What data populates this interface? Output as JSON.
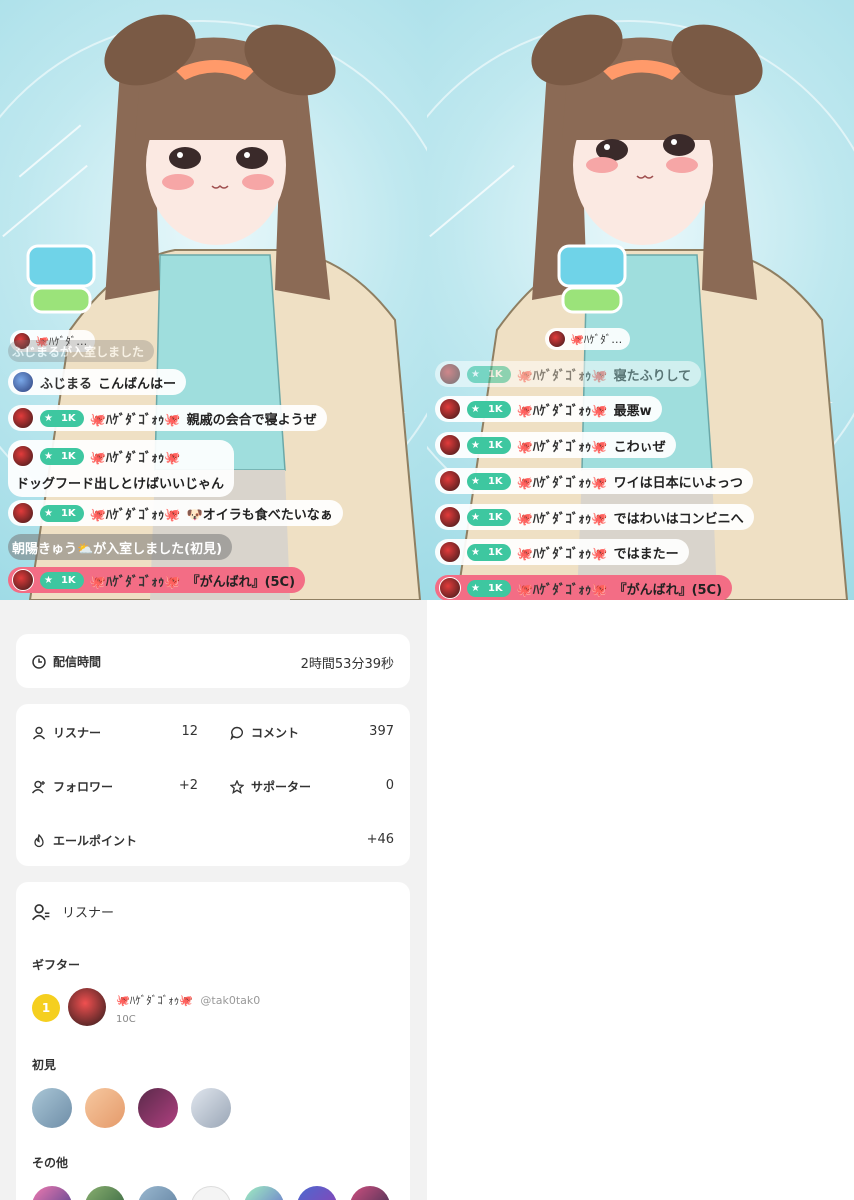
{
  "left_stream": {
    "sticker_alt": "カツんばれ",
    "notice_top": "ふじまるが入室しました",
    "mini_tag": "🐙ﾊｹﾞﾀﾞ…",
    "messages": [
      {
        "user": "ふじまる",
        "text": "こんばんはー"
      },
      {
        "badge": "1K",
        "user": "🐙ﾊｹﾞﾀﾞｺﾞｫｩ🐙",
        "text": "親戚の会合で寝ようぜ"
      },
      {
        "badge": "1K",
        "user": "🐙ﾊｹﾞﾀﾞｺﾞｫｩ🐙",
        "text": "ドッグフード出しとけばいいじゃん"
      },
      {
        "badge": "1K",
        "user": "🐙ﾊｹﾞﾀﾞｺﾞｫｩ🐙",
        "text": "🐶オイラも食べたいなぁ"
      },
      {
        "text": "朝陽きゅう⛅が入室しました(初見)"
      },
      {
        "badge": "1K",
        "user": "🐙ﾊｹﾞﾀﾞｺﾞｫｩ🐙",
        "text": "『がんばれ』(5C)"
      }
    ]
  },
  "right_stream": {
    "sticker_alt": "カツんばれ",
    "mini_tag": "🐙ﾊｹﾞﾀﾞ…",
    "messages": [
      {
        "badge": "1K",
        "user": "🐙ﾊｹﾞﾀﾞｺﾞｫｩ🐙",
        "text": "寝たふりして"
      },
      {
        "badge": "1K",
        "user": "🐙ﾊｹﾞﾀﾞｺﾞｫｩ🐙",
        "text": "最悪w"
      },
      {
        "badge": "1K",
        "user": "🐙ﾊｹﾞﾀﾞｺﾞｫｩ🐙",
        "text": "こわぃぜ"
      },
      {
        "badge": "1K",
        "user": "🐙ﾊｹﾞﾀﾞｺﾞｫｩ🐙",
        "text": "ワイは日本にいよっつ"
      },
      {
        "badge": "1K",
        "user": "🐙ﾊｹﾞﾀﾞｺﾞｫｩ🐙",
        "text": "ではわいはコンビニへ"
      },
      {
        "badge": "1K",
        "user": "🐙ﾊｹﾞﾀﾞｺﾞｫｩ🐙",
        "text": "ではまたー"
      },
      {
        "badge": "1K",
        "user": "🐙ﾊｹﾞﾀﾞｺﾞｫｩ🐙",
        "text": "『がんばれ』(5C)"
      }
    ]
  },
  "stats": {
    "duration_label": "配信時間",
    "duration_value": "2時間53分39秒",
    "listeners_label": "リスナー",
    "listeners_value": "12",
    "comments_label": "コメント",
    "comments_value": "397",
    "followers_label": "フォロワー",
    "followers_value": "+2",
    "supporters_label": "サポーター",
    "supporters_value": "0",
    "yell_label": "エールポイント",
    "yell_value": "+46"
  },
  "listeners_section": {
    "title": "リスナー",
    "gifters_heading": "ギフター",
    "gifter": {
      "rank": "1",
      "name": "🐙ﾊｹﾞﾀﾞｺﾞｫｩ🐙",
      "handle": "@tak0tak0",
      "amount": "10C"
    },
    "first_time_heading": "初見",
    "others_heading": "その他"
  },
  "colors": {
    "accent_green": "#3ec7a0",
    "gift_pink": "#f36d85",
    "gold": "#f5cf1f"
  }
}
